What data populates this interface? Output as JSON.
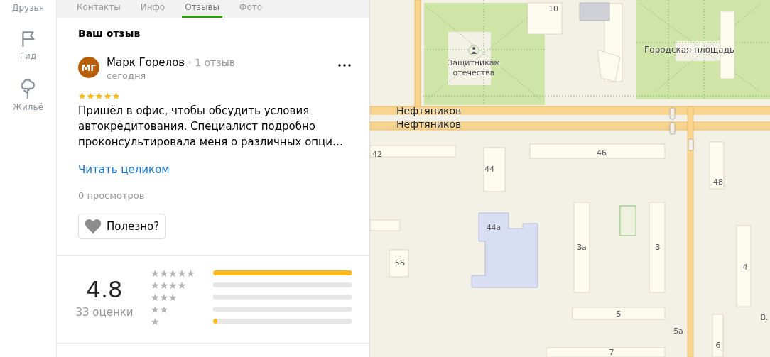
{
  "sidebar": {
    "items": [
      {
        "label": "Друзья"
      },
      {
        "label": "Гид"
      },
      {
        "label": "Жильё"
      }
    ]
  },
  "tabs": [
    {
      "label": "Контакты",
      "selected": false
    },
    {
      "label": "Инфо",
      "selected": false
    },
    {
      "label": "Отзывы",
      "selected": true
    },
    {
      "label": "Фото",
      "selected": false
    }
  ],
  "my_review": {
    "heading": "Ваш отзыв",
    "author": {
      "initials": "МГ",
      "name": "Марк Горелов",
      "reviews": "1 отзыв",
      "date": "сегодня"
    },
    "stars": 5,
    "text": "Пришёл в офис, чтобы обсудить условия автокредитования. Специалист подробно проконсультировала меня о различных опци…",
    "read_more": "Читать целиком",
    "views": "0 просмотров",
    "helpful": "Полезно?"
  },
  "rating": {
    "value": "4.8",
    "count": "33 оценки",
    "rows": [
      {
        "label": "★★★★★",
        "level": 1.0
      },
      {
        "label": "★★★★",
        "level": 0
      },
      {
        "label": "★★★",
        "level": 0
      },
      {
        "label": "★★",
        "level": 0
      },
      {
        "label": "★",
        "level": 0.03
      }
    ]
  },
  "map": {
    "labels": [
      "Защитникам отечества",
      "Городская площадь",
      "Нефтяников",
      "Нефтяников",
      "10",
      "42",
      "44",
      "46",
      "48",
      "44а",
      "5Б",
      "3а",
      "3",
      "4",
      "5",
      "5а",
      "6",
      "7",
      "В."
    ]
  }
}
